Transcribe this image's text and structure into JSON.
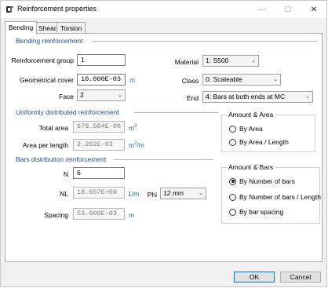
{
  "window": {
    "title": "Reinforcement properties",
    "controls": {
      "minimize": "—",
      "maximize": "☐",
      "close": "✕"
    }
  },
  "tabs": [
    {
      "label": "Bending",
      "active": true
    },
    {
      "label": "Shear",
      "active": false
    },
    {
      "label": "Torsion",
      "active": false
    }
  ],
  "bending": {
    "section_title": "Bending reinforcement",
    "reinforcement_group": {
      "label": "Reinforcement group",
      "value": "1"
    },
    "geometrical_cover": {
      "label": "Geometrical cover",
      "value": "10.000E-03",
      "unit": "m"
    },
    "face": {
      "label": "Face",
      "value": "2"
    },
    "material": {
      "label": "Material",
      "value": "1: S500"
    },
    "class": {
      "label": "Class",
      "value": "0: Scaleable"
    },
    "end": {
      "label": "End",
      "value": "4: Bars at both ends at MC"
    }
  },
  "udr": {
    "section_title": "Uniformly distributed reinforcement",
    "total_area": {
      "label": "Total area",
      "value": "678.584E-06",
      "unit": "m",
      "unit_sup": "2"
    },
    "area_per_length": {
      "label": "Area per length",
      "value": "2.262E-03",
      "unit": "m",
      "unit_sup": "2",
      "unit_tail": "/m"
    },
    "group_title": "Amount & Area",
    "options": [
      {
        "label": "By Area",
        "checked": false
      },
      {
        "label": "By Area /  Length",
        "checked": false
      }
    ]
  },
  "bars": {
    "section_title": "Bars distribution reinforcement",
    "n": {
      "label": "N",
      "value": "6"
    },
    "nl": {
      "label": "NL",
      "value": "18.657E+00",
      "unit": "1/m"
    },
    "phi": {
      "label": "Phi",
      "value": "12 mm"
    },
    "spacing": {
      "label": "Spacing",
      "value": "53.600E-03",
      "unit": "m"
    },
    "group_title": "Amount & Bars",
    "options": [
      {
        "label": "By Number of bars",
        "checked": true
      },
      {
        "label": "By Number of bars / Length",
        "checked": false
      },
      {
        "label": "By bar spacing",
        "checked": false
      }
    ]
  },
  "buttons": {
    "ok": "OK",
    "cancel": "Cancel"
  },
  "icons": {
    "title": "app-logo-icon",
    "dropdown": "chevron-down-icon"
  },
  "colors": {
    "section_title": "#1f4f9a",
    "unit": "#1f6fa6",
    "default_button_border": "#0078d7"
  }
}
